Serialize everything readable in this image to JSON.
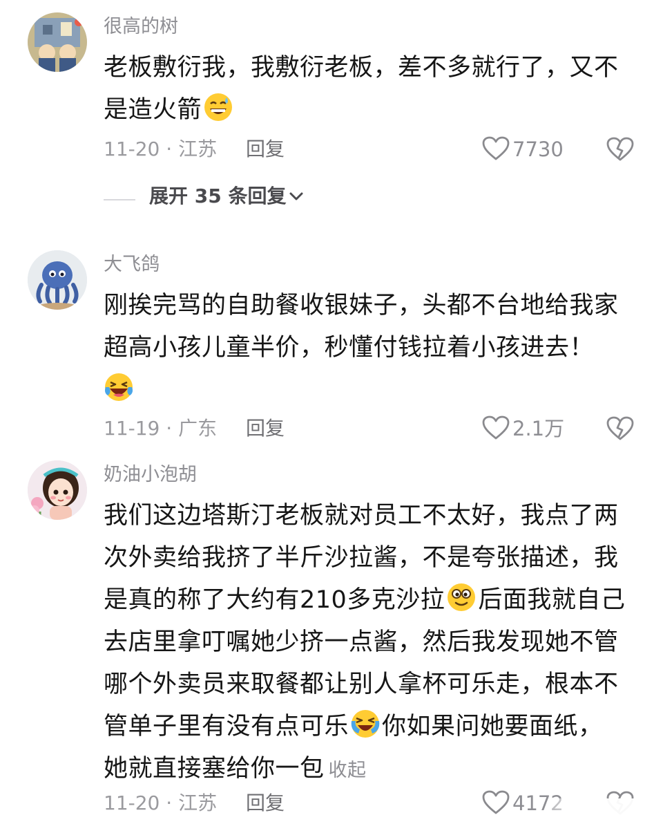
{
  "comments": [
    {
      "username": "很高的树",
      "avatar": "avatar-cartoon-scene",
      "lines": [
        {
          "text": "老板敷衍我，我敷衍老板，差不多就行了，又不"
        },
        {
          "text": "是造火箭",
          "emoji": "grinning-sweat-emoji"
        }
      ],
      "date_location": "11-20 · 江苏",
      "reply_label": "回复",
      "likes": "7730",
      "expand_label": "展开 35 条回复"
    },
    {
      "username": "大飞鸽",
      "avatar": "avatar-octopus",
      "lines": [
        {
          "text": "刚挨完骂的自助餐收银妹子，头都不台地给我家"
        },
        {
          "text": "超高小孩儿童半价，秒懂付钱拉着小孩进去！"
        },
        {
          "text": "",
          "emoji": "laughing-tears-emoji"
        }
      ],
      "date_location": "11-19 · 广东",
      "reply_label": "回复",
      "likes": "2.1万"
    },
    {
      "username": "奶油小泡胡",
      "avatar": "avatar-cartoon-girl",
      "lines": [
        {
          "text": "我们这边塔斯汀老板就对员工不太好，我点了两"
        },
        {
          "text": "次外卖给我挤了半斤沙拉酱，不是夸张描述，我"
        },
        {
          "text": "是真的称了大约有210多克沙拉",
          "emoji": "silly-face-emoji",
          "after": "后面我就自己"
        },
        {
          "text": "去店里拿叮嘱她少挤一点酱，然后我发现她不管"
        },
        {
          "text": "哪个外卖员来取餐都让别人拿杯可乐走，根本不"
        },
        {
          "text": "管单子里有没有点可乐",
          "emoji": "crying-laugh-emoji",
          "after": "你如果问她要面纸，"
        },
        {
          "text": "她就直接塞给你一包"
        }
      ],
      "collapse_label": "收起",
      "date_location": "11-20 · 江苏",
      "reply_label": "回复",
      "likes": "4172"
    }
  ],
  "icons": {
    "like": "heart-icon",
    "dislike": "broken-heart-icon",
    "expand": "chevron-down-icon"
  },
  "colors": {
    "username": "#8e8e93",
    "body": "#161616",
    "meta": "#9a9a9e",
    "emoji_yellow": "#ffcc33"
  }
}
